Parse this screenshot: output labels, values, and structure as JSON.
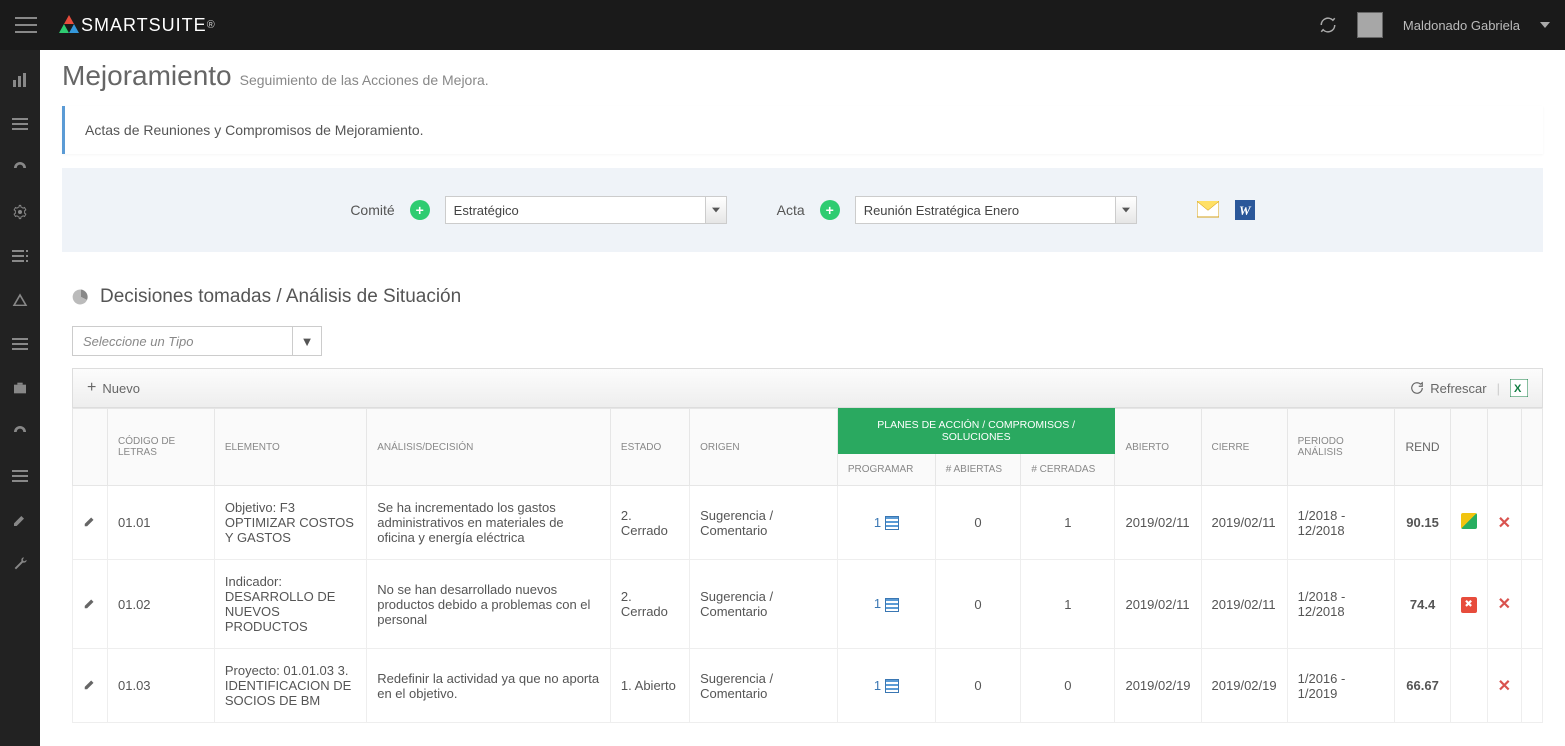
{
  "header": {
    "brand": "SMARTSUITE",
    "user_name": "Maldonado Gabriela"
  },
  "page": {
    "title": "Mejoramiento",
    "subtitle": "Seguimiento de las Acciones de Mejora.",
    "notice": "Actas de Reuniones y Compromisos de Mejoramiento."
  },
  "filters": {
    "comite_label": "Comité",
    "comite_value": "Estratégico",
    "acta_label": "Acta",
    "acta_value": "Reunión Estratégica Enero"
  },
  "section": {
    "title": "Decisiones tomadas / Análisis de Situación",
    "type_placeholder": "Seleccione un Tipo",
    "new_label": "Nuevo",
    "refresh_label": "Refrescar"
  },
  "table": {
    "headers": {
      "codigo": "CÓDIGO DE LETRAS",
      "elemento": "ELEMENTO",
      "analisis": "ANÁLISIS/DECISIÓN",
      "estado": "ESTADO",
      "origen": "ORIGEN",
      "group": "PLANES DE ACCIÓN / COMPROMISOS / SOLUCIONES",
      "programar": "PROGRAMAR",
      "abiertas": "# ABIERTAS",
      "cerradas": "# CERRADAS",
      "abierto": "ABIERTO",
      "cierre": "CIERRE",
      "periodo": "PERIODO ANÁLISIS",
      "rend": "REND"
    },
    "rows": [
      {
        "codigo": "01.01",
        "elemento": "Objetivo: F3 OPTIMIZAR COSTOS Y GASTOS",
        "analisis": "Se ha incrementado los gastos administrativos en materiales de oficina y energía eléctrica",
        "estado": "2. Cerrado",
        "origen": "Sugerencia / Comentario",
        "programar": "1",
        "abiertas": "0",
        "cerradas": "1",
        "abierto": "2019/02/11",
        "cierre": "2019/02/11",
        "periodo": "1/2018 - 12/2018",
        "rend": "90.15",
        "chip": "yellow"
      },
      {
        "codigo": "01.02",
        "elemento": "Indicador: DESARROLLO DE NUEVOS PRODUCTOS",
        "analisis": "No se han desarrollado nuevos productos debido a problemas con el personal",
        "estado": "2. Cerrado",
        "origen": "Sugerencia / Comentario",
        "programar": "1",
        "abiertas": "0",
        "cerradas": "1",
        "abierto": "2019/02/11",
        "cierre": "2019/02/11",
        "periodo": "1/2018 - 12/2018",
        "rend": "74.4",
        "chip": "red"
      },
      {
        "codigo": "01.03",
        "elemento": "Proyecto: 01.01.03 3. IDENTIFICACION DE SOCIOS DE BM",
        "analisis": "Redefinir la actividad ya que no aporta en el objetivo.",
        "estado": "1. Abierto",
        "origen": "Sugerencia / Comentario",
        "programar": "1",
        "abiertas": "0",
        "cerradas": "0",
        "abierto": "2019/02/19",
        "cierre": "2019/02/19",
        "periodo": "1/2016 - 1/2019",
        "rend": "66.67",
        "chip": ""
      }
    ]
  }
}
